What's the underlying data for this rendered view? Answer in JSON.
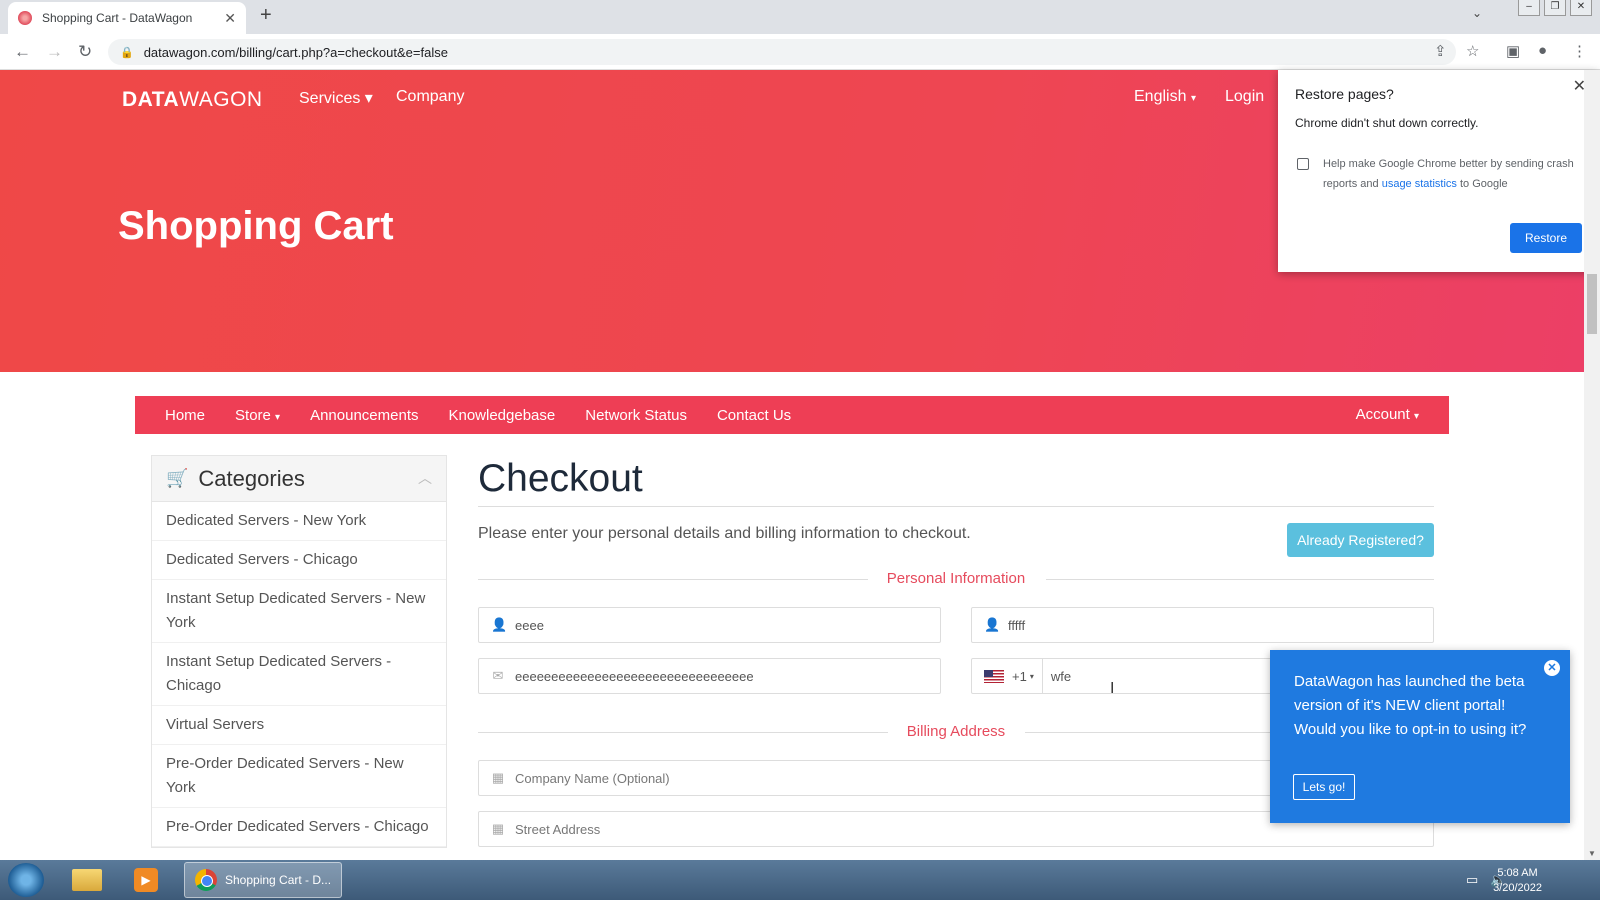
{
  "browser": {
    "tab_title": "Shopping Cart - DataWagon",
    "url": "datawagon.com/billing/cart.php?a=checkout&e=false"
  },
  "site": {
    "logo_bold": "DATA",
    "logo_light": "WAGON",
    "nav": {
      "services": "Services",
      "company": "Company",
      "language": "English",
      "login": "Login"
    },
    "hero_title": "Shopping Cart"
  },
  "restore_popup": {
    "title": "Restore pages?",
    "subtitle": "Chrome didn't shut down correctly.",
    "help_pre": "Help make Google Chrome better by sending crash reports and ",
    "help_link": "usage statistics",
    "help_post": " to Google",
    "button": "Restore"
  },
  "main_nav": {
    "items": [
      "Home",
      "Store",
      "Announcements",
      "Knowledgebase",
      "Network Status",
      "Contact Us"
    ],
    "account": "Account"
  },
  "sidebar": {
    "title": "Categories",
    "items": [
      "Dedicated Servers - New York",
      "Dedicated Servers - Chicago",
      "Instant Setup Dedicated Servers - New York",
      "Instant Setup Dedicated Servers - Chicago",
      "Virtual Servers",
      "Pre-Order Dedicated Servers - New York",
      "Pre-Order Dedicated Servers - Chicago"
    ]
  },
  "checkout": {
    "title": "Checkout",
    "lead": "Please enter your personal details and billing information to checkout.",
    "already_registered": "Already Registered?",
    "personal_section": "Personal Information",
    "billing_section": "Billing Address",
    "first_name": "eeee",
    "last_name": "fffff",
    "email": "eeeeeeeeeeeeeeeeeeeeeeeeeeeeeeeee",
    "phone_code": "+1",
    "phone": "wfe",
    "company_placeholder": "Company Name (Optional)",
    "street_placeholder": "Street Address"
  },
  "notice": {
    "text": "DataWagon has launched the beta version of it's NEW client portal! Would you like to opt-in to using it?",
    "button": "Lets go!"
  },
  "taskbar": {
    "task_label": "Shopping Cart - D...",
    "time": "5:08 AM",
    "date": "3/20/2022"
  }
}
